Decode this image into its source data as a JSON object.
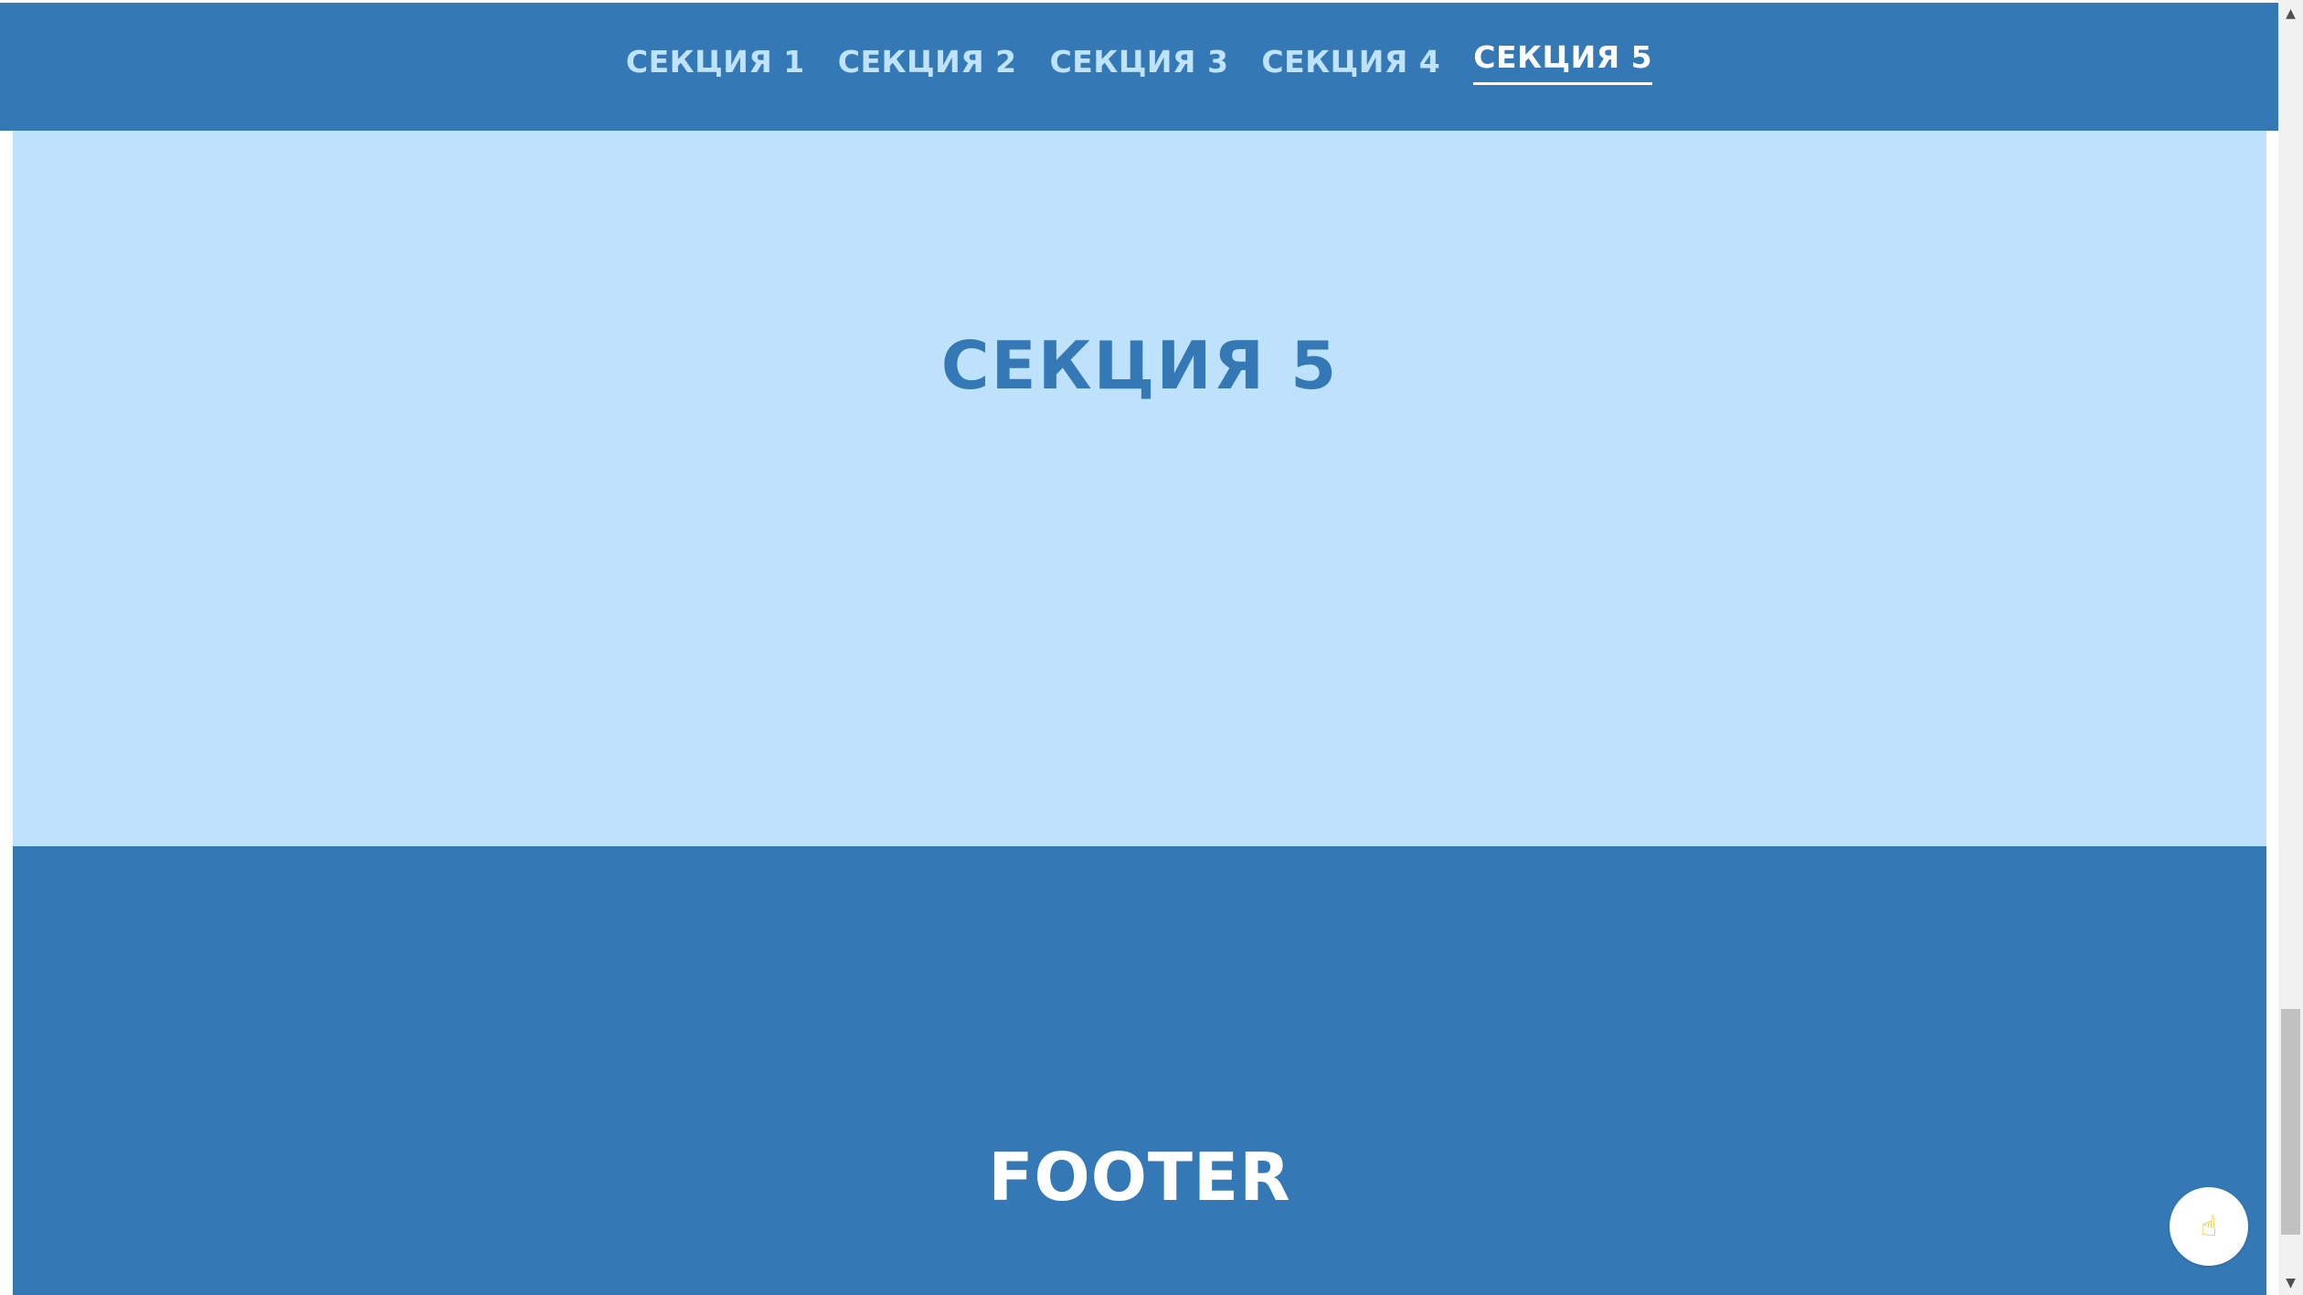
{
  "nav": {
    "items": [
      {
        "label": "СЕКЦИЯ 1"
      },
      {
        "label": "СЕКЦИЯ 2"
      },
      {
        "label": "СЕКЦИЯ 3"
      },
      {
        "label": "СЕКЦИЯ 4"
      },
      {
        "label": "СЕКЦИЯ 5"
      }
    ],
    "active_index": 4
  },
  "section": {
    "title": "СЕКЦИЯ 5"
  },
  "footer": {
    "title": "FOOTER"
  },
  "scroll_button": {
    "icon": "pointing-up-hand-icon",
    "glyph": "☝"
  },
  "colors": {
    "header_bg": "#3479b5",
    "nav_text": "#bfe3fc",
    "nav_active": "#ffffff",
    "section_bg": "#bee2fc",
    "section_title": "#3479b5",
    "footer_bg": "#3479b5",
    "footer_text": "#ffffff"
  }
}
